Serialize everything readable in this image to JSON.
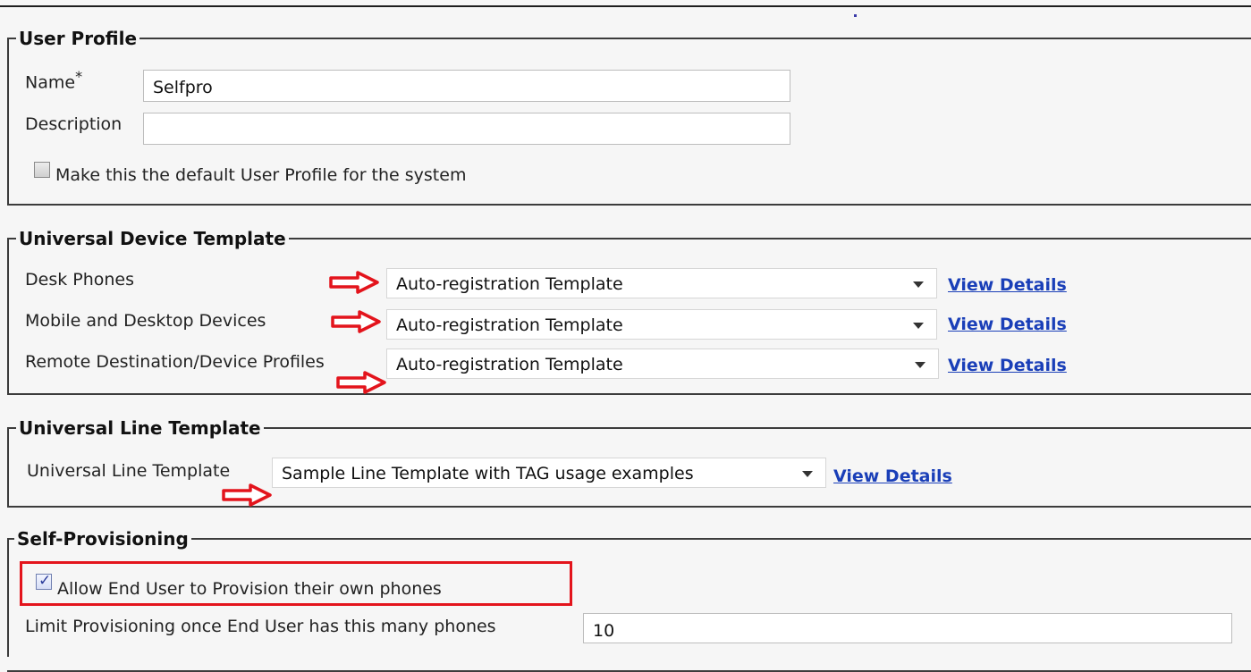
{
  "user_profile": {
    "legend": "User Profile",
    "name_label": "Name",
    "required_marker": "*",
    "name_value": "Selfpro",
    "description_label": "Description",
    "description_value": "",
    "default_checkbox_label": "Make this the default User Profile for the system",
    "default_checked": false
  },
  "device_template": {
    "legend": "Universal Device Template",
    "rows": [
      {
        "label": "Desk Phones",
        "value": "Auto-registration Template",
        "link": "View Details"
      },
      {
        "label": "Mobile and Desktop Devices",
        "value": "Auto-registration Template",
        "link": "View Details"
      },
      {
        "label": "Remote Destination/Device Profiles",
        "value": "Auto-registration Template",
        "link": "View Details"
      }
    ]
  },
  "line_template": {
    "legend": "Universal Line Template",
    "label": "Universal Line Template",
    "value": "Sample Line Template with TAG usage examples",
    "link": "View Details"
  },
  "self_provisioning": {
    "legend": "Self-Provisioning",
    "allow_label": "Allow End User to Provision their own phones",
    "allow_checked": true,
    "limit_label": "Limit Provisioning once End User has this many phones",
    "limit_value": "10"
  },
  "colors": {
    "annotation_red": "#e3141c",
    "link_blue": "#1a3fb8"
  },
  "icons": [
    "red-arrow-icon",
    "dropdown-caret-icon",
    "checkbox-icon",
    "checkmark-icon"
  ]
}
